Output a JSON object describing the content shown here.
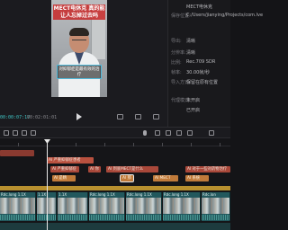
{
  "preview": {
    "video_title": "MECT电休克 真的能让人忘掉过去吗",
    "caption": "对抑郁症是最有效的治疗",
    "timecode_current": "00:00:07:17",
    "timecode_total": "00:02:01:01"
  },
  "properties": {
    "rows": [
      {
        "label": "",
        "value": "MECT电休克"
      },
      {
        "label": "保存位置:",
        "value": "C:/Users/jianying/Projects/com.lve"
      },
      {
        "label": "",
        "value": ""
      },
      {
        "label": "导出:",
        "value": "清晰"
      },
      {
        "label": "分辨率:",
        "value": "清晰"
      },
      {
        "label": "比例:",
        "value": "Rec.709 SDR"
      },
      {
        "label": "帧率:",
        "value": "30.00帧/秒"
      },
      {
        "label": "导入方式:",
        "value": "保留在原有位置"
      },
      {
        "label": "",
        "value": ""
      },
      {
        "label": "代理模式:",
        "value": "未开启"
      },
      {
        "label": "",
        "value": "已开启"
      }
    ]
  },
  "timeline": {
    "red_track_1": [
      {
        "label": "Al 严重抑郁症患者"
      },
      {
        "label": ""
      }
    ],
    "red_track_2": [
      {
        "label": "Al 严重抑郁症"
      },
      {
        "label": "Al 你"
      },
      {
        "label": "Al 到底MECT是什么"
      },
      {
        "label": "Al 对于一些对药物治疗"
      }
    ],
    "orange_track": [
      {
        "label": "Al 是精"
      },
      {
        "label": "Al 那"
      },
      {
        "label": "Al MECT"
      },
      {
        "label": "Al 系统"
      }
    ],
    "video_clips": [
      {
        "label": "Rdc.long 1.1X"
      },
      {
        "label": "1.1X"
      },
      {
        "label": "1.1X"
      },
      {
        "label": "Rdc.long 1.1X"
      },
      {
        "label": "Rdc.long 1.1X"
      },
      {
        "label": "Rdc.long 1.1X"
      },
      {
        "label": "Rdc.lon"
      }
    ]
  }
}
